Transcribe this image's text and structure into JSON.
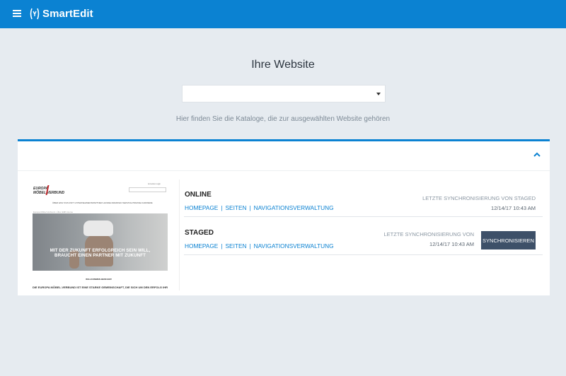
{
  "app": {
    "title": "SmartEdit"
  },
  "page": {
    "title": "Ihre Website",
    "site_select": {
      "value": ""
    },
    "subtitle": "Hier finden Sie die Kataloge, die zur ausgewählten Website gehören"
  },
  "preview": {
    "logo_line1": "EUROPA",
    "logo_line2": "MÖBEL VERBUND",
    "util_text": "Anmelden   Login",
    "nav_text": "ÜBER EMV    ZUKUNFT    UNTERNEHMENSPARTNER    HANDELSMARKEN    SERVICE    PRESSE    KARRIERE",
    "breadcrumb": "Europa Möbel Verbund › Über EMV Home",
    "hero_line1": "MIT DER ZUKUNFT ERFOLGREICH SEIN WILL,",
    "hero_line2": "BRAUCHT EINEN PARTNER MIT ZUKUNFT",
    "welcome": "WILLKOMMEN BEIM EMV",
    "bottom_line": "DIE EUROPA MÖBEL-VERBUND IST EINE STARKE GEMEINSCHAFT, DIE SICH UM DEN ERFOLG IHRER MITGLIEDER KÜMMERT"
  },
  "catalogs": [
    {
      "name": "ONLINE",
      "links": [
        "HOMEPAGE",
        "SEITEN",
        "NAVIGATIONSVERWALTUNG"
      ],
      "sync_label": "LETZTE SYNCHRONISIERUNG VON STAGED",
      "sync_date": "12/14/17 10:43 AM"
    },
    {
      "name": "STAGED",
      "links": [
        "HOMEPAGE",
        "SEITEN",
        "NAVIGATIONSVERWALTUNG"
      ],
      "sync_label": "LETZTE SYNCHRONISIERUNG VON",
      "sync_date": "12/14/17 10:43 AM",
      "sync_button": "SYNCHRONISIEREN"
    }
  ],
  "colors": {
    "topbar": "#0b82d2",
    "link": "#0b82d2",
    "button": "#3d5068",
    "background": "#e6ebf0"
  },
  "icons": {
    "menu": "hamburger-icon",
    "logo": "smartedit-logo-icon",
    "dropdown": "caret-down-icon",
    "collapse": "chevron-up-icon"
  }
}
